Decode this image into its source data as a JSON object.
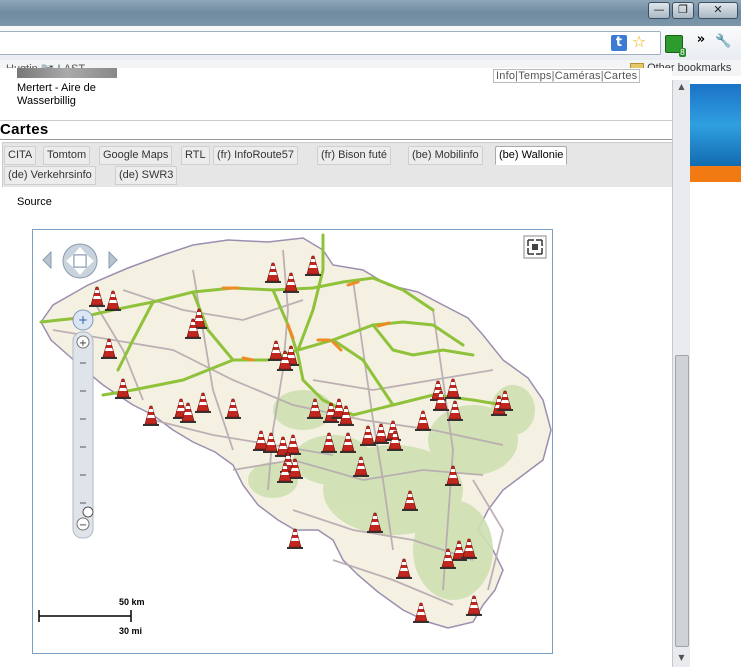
{
  "window": {
    "buttons": [
      "—",
      "❐",
      "✕"
    ]
  },
  "toolbar": {
    "overflow": "»",
    "ext_badge": "8"
  },
  "bookmarks": {
    "fragment_left": "Hugtin 📷 LAST",
    "other_label": "Other bookmarks"
  },
  "page": {
    "top_location": "Mertert - Aire de Wasserbillig",
    "top_links": [
      "Info",
      "Temps",
      "Caméras",
      "Cartes"
    ],
    "section_title": "Cartes",
    "tabs": [
      {
        "label": "CITA"
      },
      {
        "label": "Tomtom"
      },
      {
        "label": "Google Maps"
      },
      {
        "label": "RTL"
      },
      {
        "label": "(fr) InfoRoute57"
      },
      {
        "label": "(fr) Bison futé"
      },
      {
        "label": "(be) Mobilinfo"
      },
      {
        "label": "(be) Wallonie",
        "active": true
      },
      {
        "label": "(de) Verkehrsinfo"
      },
      {
        "label": "(de) SWR3"
      }
    ],
    "source_label": "Source"
  },
  "map": {
    "scale_km": "50 km",
    "scale_mi": "30 mi",
    "colors": {
      "land": "#f4f1e2",
      "forest": "#cfe0b2",
      "border": "#9b8fb0",
      "road": "#b7a9b0",
      "highway": "#8fc23a",
      "jam": "#f08a24",
      "cone": "#c2271f"
    },
    "cone_count": 52
  }
}
